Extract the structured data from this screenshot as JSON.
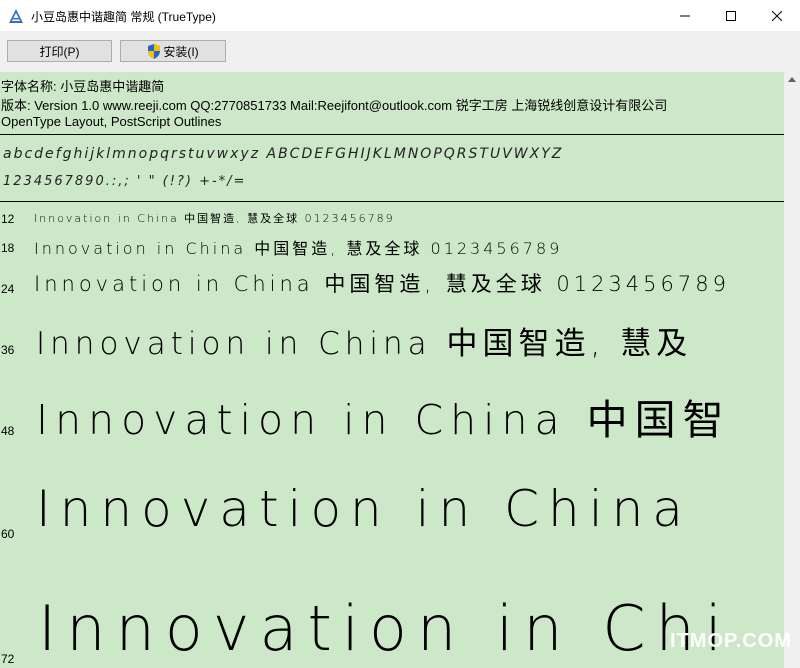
{
  "window": {
    "title": "小豆岛惠中谐趣简 常规 (TrueType)"
  },
  "toolbar": {
    "print_label": "打印(P)",
    "install_label": "安装(I)"
  },
  "info": {
    "font_name": "字体名称: 小豆岛惠中谐趣简",
    "version": "版本: Version 1.0  www.reeji.com QQ:2770851733 Mail:Reejifont@outlook.com 锐字工房 上海锐线创意设计有限公司",
    "outlines": "OpenType Layout, PostScript Outlines"
  },
  "charset": {
    "letters": "abcdefghijklmnopqrstuvwxyz ABCDEFGHIJKLMNOPQRSTUVWXYZ",
    "digits": "1234567890.:,; ' \" (!?) +-*/="
  },
  "samples": [
    {
      "size": "12",
      "text": "Innovation in China 中国智造, 慧及全球 0123456789"
    },
    {
      "size": "18",
      "text": "Innovation in China 中国智造, 慧及全球 0123456789"
    },
    {
      "size": "24",
      "text": "Innovation in China 中国智造, 慧及全球 0123456789"
    },
    {
      "size": "36",
      "text": "Innovation in China 中国智造, 慧及"
    },
    {
      "size": "48",
      "text": "Innovation in China 中国智"
    },
    {
      "size": "60",
      "text": "Innovation in China"
    },
    {
      "size": "72",
      "text": "Innovation in Chi"
    }
  ],
  "watermark": "ITMOP.COM"
}
